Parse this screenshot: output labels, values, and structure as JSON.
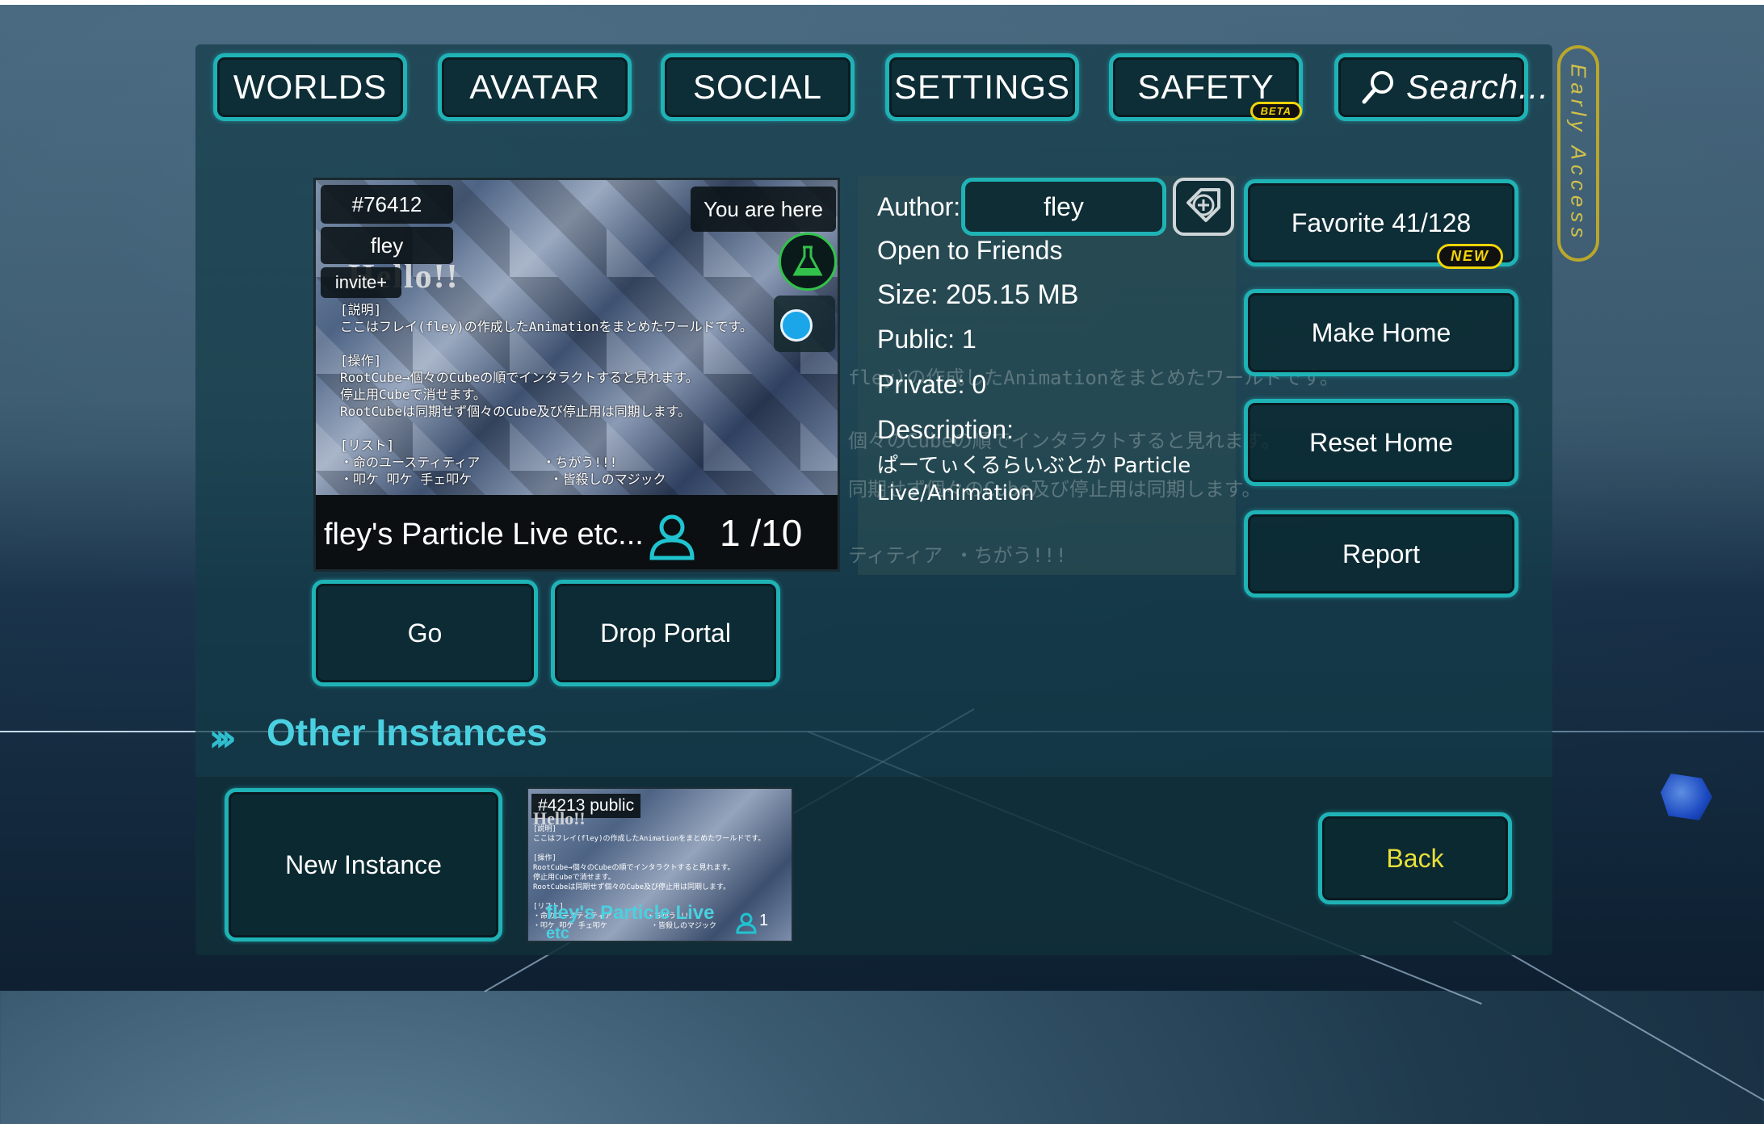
{
  "nav": {
    "worlds": "WORLDS",
    "avatar": "AVATAR",
    "social": "SOCIAL",
    "settings": "SETTINGS",
    "safety": "SAFETY",
    "safety_badge": "BETA",
    "search_placeholder": "Search..."
  },
  "early_access": "Early Access",
  "world": {
    "instance_id": "#76412",
    "owner": "fley",
    "invite": "invite+",
    "you_are_here": "You are here",
    "hello_banner": "Hello!!",
    "thumbnail_text": "[説明]\nここはフレイ(fley)の作成したAnimationをまとめたワールドです。\n\n[操作]\nRootCube→個々のCubeの順でインタラクトすると見れます。\n停止用Cubeで消せます。\nRootCubeは同期せず個々のCube及び停止用は同期します。\n\n[リスト]\n・命のユースティティア        ・ちがう!!!\n・叩ケ 叩ケ 手ェ叩ケ          ・皆殺しのマジック",
    "name": "fley's Particle Live etc...",
    "occupancy": "1 /10"
  },
  "info": {
    "author_label": "Author:",
    "author_name": "fley",
    "access": "Open to Friends",
    "size": "Size: 205.15 MB",
    "public": "Public: 1",
    "private": "Private: 0",
    "description_label": "Description:",
    "description": "ぱーてぃくるらいぶとか Particle Live/Animation"
  },
  "actions": {
    "favorite": "Favorite 41/128",
    "favorite_badge": "NEW",
    "make_home": "Make Home",
    "reset_home": "Reset Home",
    "report": "Report",
    "go": "Go",
    "drop_portal": "Drop Portal"
  },
  "other_instances": {
    "title": "Other Instances",
    "new_instance": "New Instance",
    "instances": [
      {
        "label": "#4213 public",
        "banner": "Hello!!",
        "name": "fley's Particle Live",
        "name_cont": "etc",
        "count": "1"
      }
    ]
  },
  "back": "Back",
  "colors": {
    "accent": "#1fb3b6",
    "title": "#4ad0e0",
    "badge": "#f1d40a",
    "back_text": "#e8e03a"
  }
}
